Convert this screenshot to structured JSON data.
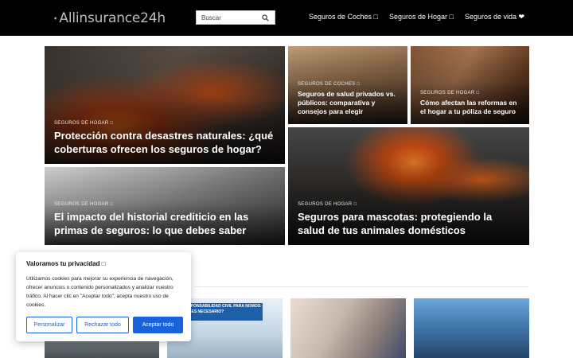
{
  "header": {
    "logo_text": "Allinsurance24h",
    "search_placeholder": "Buscar",
    "nav": [
      "Seguros de Coches □",
      "Seguros de Hogar □",
      "Seguros de vida ❤"
    ]
  },
  "featured": [
    {
      "category": "SEGUROS DE HOGAR □",
      "title": "Protección contra desastres naturales: ¿qué coberturas ofrecen los seguros de hogar?"
    },
    {
      "category": "SEGUROS DE COCHES □",
      "title": "Seguros de salud privados vs. públicos: comparativa y consejos para elegir"
    },
    {
      "category": "SEGUROS DE HOGAR □",
      "title": "Cómo afectan las reformas en el hogar a tu póliza de seguro"
    },
    {
      "category": "SEGUROS DE HOGAR □",
      "title": "El impacto del historial crediticio en las primas de seguros: lo que debes saber"
    },
    {
      "category": "SEGUROS DE HOGAR □",
      "title": "Seguros para mascotas: protegiendo la salud de tus animales domésticos"
    }
  ],
  "thumb2_text": "ES DE RESPONSABILIDAD CIVIL PARA NOMOS: ¿POR QUÉ ES NECESARIO?",
  "cookie": {
    "title": "Valoramos tu privacidad □",
    "body": "Utilizamos cookies para mejorar su experiencia de navegación, ofrecer anuncios o contenido personalizados y analizar nuestro tráfico. Al hacer clic en \"Aceptar todo\", acepta nuestro uso de cookies.",
    "customize": "Personalizar",
    "reject": "Rechazar todo",
    "accept": "Aceptar todo"
  }
}
